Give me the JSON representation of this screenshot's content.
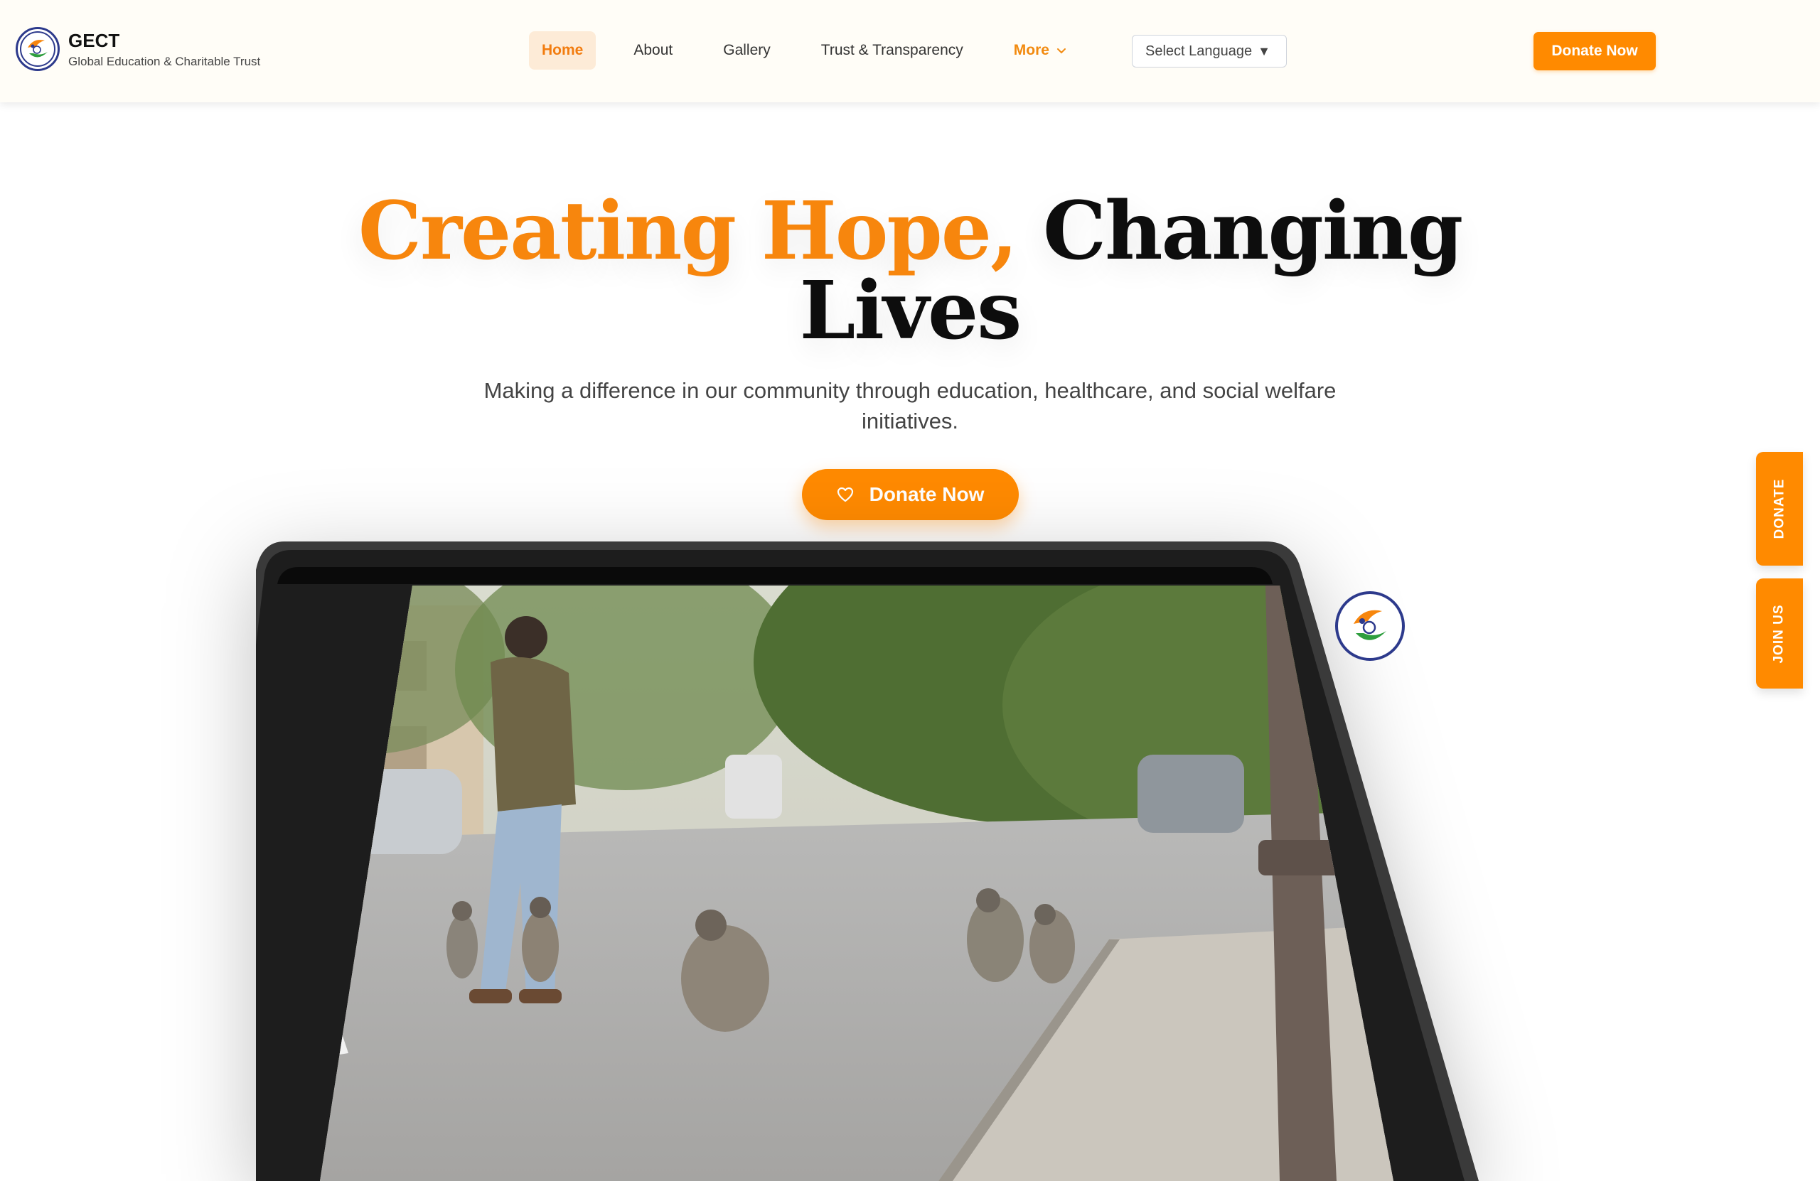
{
  "brand": {
    "name": "GECT",
    "subtitle": "Global Education & Charitable Trust"
  },
  "nav": {
    "items": [
      {
        "label": "Home",
        "active": true
      },
      {
        "label": "About"
      },
      {
        "label": "Gallery"
      },
      {
        "label": "Trust & Transparency"
      }
    ],
    "more_label": "More"
  },
  "language": {
    "label": "Select Language",
    "caret": "▼"
  },
  "header_cta": "Donate Now",
  "hero": {
    "title_accent": "Creating Hope,",
    "title_rest": "Changing Lives",
    "subtitle": "Making a difference in our community through education, healthcare, and social welfare initiatives.",
    "cta_label": "Donate Now"
  },
  "side_tabs": {
    "donate": "DONATE",
    "join": "JOIN US"
  },
  "colors": {
    "brand_orange": "#ff8a00",
    "title_orange": "#f7860d",
    "logo_blue": "#2d3a8c",
    "header_bg": "#fffdf7"
  },
  "icons": {
    "heart": "heart-icon",
    "chevron": "chevron-down-icon",
    "logo": "trust-logo-icon"
  }
}
